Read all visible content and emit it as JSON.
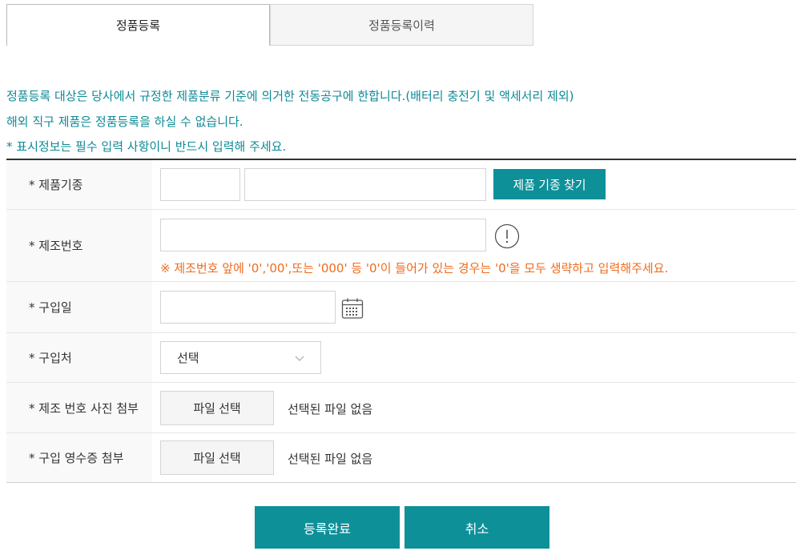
{
  "tabs": [
    {
      "label": "정품등록",
      "active": true
    },
    {
      "label": "정품등록이력",
      "active": false
    }
  ],
  "notices": [
    "정품등록 대상은 당사에서 규정한 제품분류 기준에 의거한 전동공구에 한합니다.(배터리 충전기 및 액세서리 제외)",
    "해외 직구 제품은 정품등록을 하실 수 없습니다.",
    "* 표시정보는 필수 입력 사항이니 반드시 입력해 주세요."
  ],
  "form": {
    "model": {
      "label": "* 제품기종",
      "input1_value": "",
      "input2_value": "",
      "search_button": "제품 기종 찾기"
    },
    "serial": {
      "label": "* 제조번호",
      "value": "",
      "info_icon": "exclamation-circle-icon",
      "warning": "※ 제조번호 앞에 '0','00',또는 '000' 등 '0'이 들어가 있는 경우는 '0'을 모두 생략하고 입력해주세요."
    },
    "purchase_date": {
      "label": "* 구입일",
      "value": "",
      "icon": "calendar-icon"
    },
    "store": {
      "label": "* 구입처",
      "selected": "선택"
    },
    "serial_photo": {
      "label": "* 제조 번호 사진 첨부",
      "button": "파일 선택",
      "status": "선택된 파일 없음"
    },
    "receipt": {
      "label": "* 구입 영수증 첨부",
      "button": "파일 선택",
      "status": "선택된 파일 없음"
    }
  },
  "actions": {
    "submit": "등록완료",
    "cancel": "취소"
  },
  "colors": {
    "accent": "#0e9099",
    "notice": "#0d8a96",
    "warning": "#f06b1c"
  }
}
